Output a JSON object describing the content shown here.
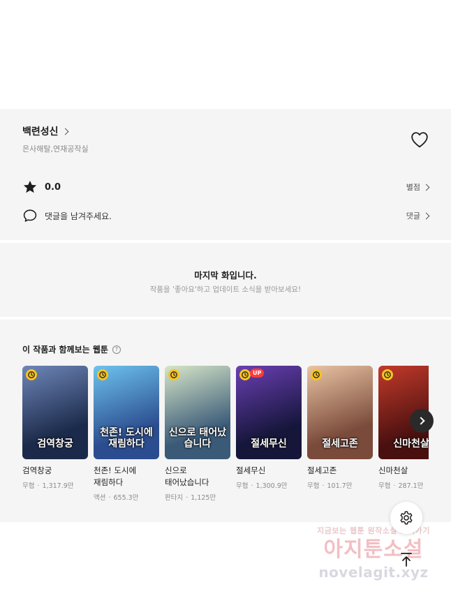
{
  "series": {
    "title": "백련성신",
    "authors": "은사해탈,연재공작실"
  },
  "rating": {
    "value": "0.0",
    "rate_label": "별점"
  },
  "comments": {
    "prompt": "댓글을 남겨주세요.",
    "link_label": "댓글"
  },
  "last_episode": {
    "title": "마지막 화입니다.",
    "subtitle": "작품을 '좋아요'하고 업데이트 소식을 받아보세요!"
  },
  "recommendations": {
    "heading": "이 작품과 함께보는 웹툰",
    "help_glyph": "?",
    "items": [
      {
        "title": "검역창궁",
        "genre": "무협",
        "views": "1,317.9만",
        "logo": "검역창궁",
        "badge": "clock",
        "colors": [
          "#1b2a4a",
          "#6e86b8"
        ]
      },
      {
        "title": "천존! 도시에 재림하다",
        "genre": "액션",
        "views": "655.3만",
        "logo": "천존! 도시에 재림하다",
        "badge": "clock",
        "colors": [
          "#2b4d8f",
          "#6ec3ee"
        ]
      },
      {
        "title": "신으로 태어났습니다",
        "genre": "판타지",
        "views": "1,125만",
        "logo": "신으로 태어났습니다",
        "badge": "clock",
        "colors": [
          "#3a5a78",
          "#d7e6c8"
        ]
      },
      {
        "title": "절세무신",
        "genre": "무협",
        "views": "1,300.9만",
        "logo": "절세무신",
        "badge": "clock",
        "up": "UP",
        "colors": [
          "#15163a",
          "#6a3fb3"
        ]
      },
      {
        "title": "절세고존",
        "genre": "무협",
        "views": "101.7만",
        "logo": "절세고존",
        "badge": "clock",
        "colors": [
          "#7a4a3a",
          "#e9c4a4"
        ]
      },
      {
        "title": "신마천살",
        "genre": "무협",
        "views": "287.1만",
        "logo": "신마천살",
        "badge": "clock",
        "colors": [
          "#4a1010",
          "#c23a2a"
        ]
      }
    ],
    "separator": "·"
  },
  "icons": {
    "heart": "heart-outline-icon",
    "star": "star-icon",
    "comment": "comment-bubble-icon",
    "settings": "gear-icon",
    "scroll_top": "arrow-up-icon",
    "next": "chevron-right-icon"
  },
  "watermark": {
    "line1": "지금보는 웹툰 원작소설 보러가기",
    "line2": "아지툰소설",
    "line3": "novelagit.xyz"
  },
  "colors": {
    "panel_bg": "#f5f5f5",
    "badge_yellow": "#f7c321",
    "up_red": "#ff3b3b"
  }
}
